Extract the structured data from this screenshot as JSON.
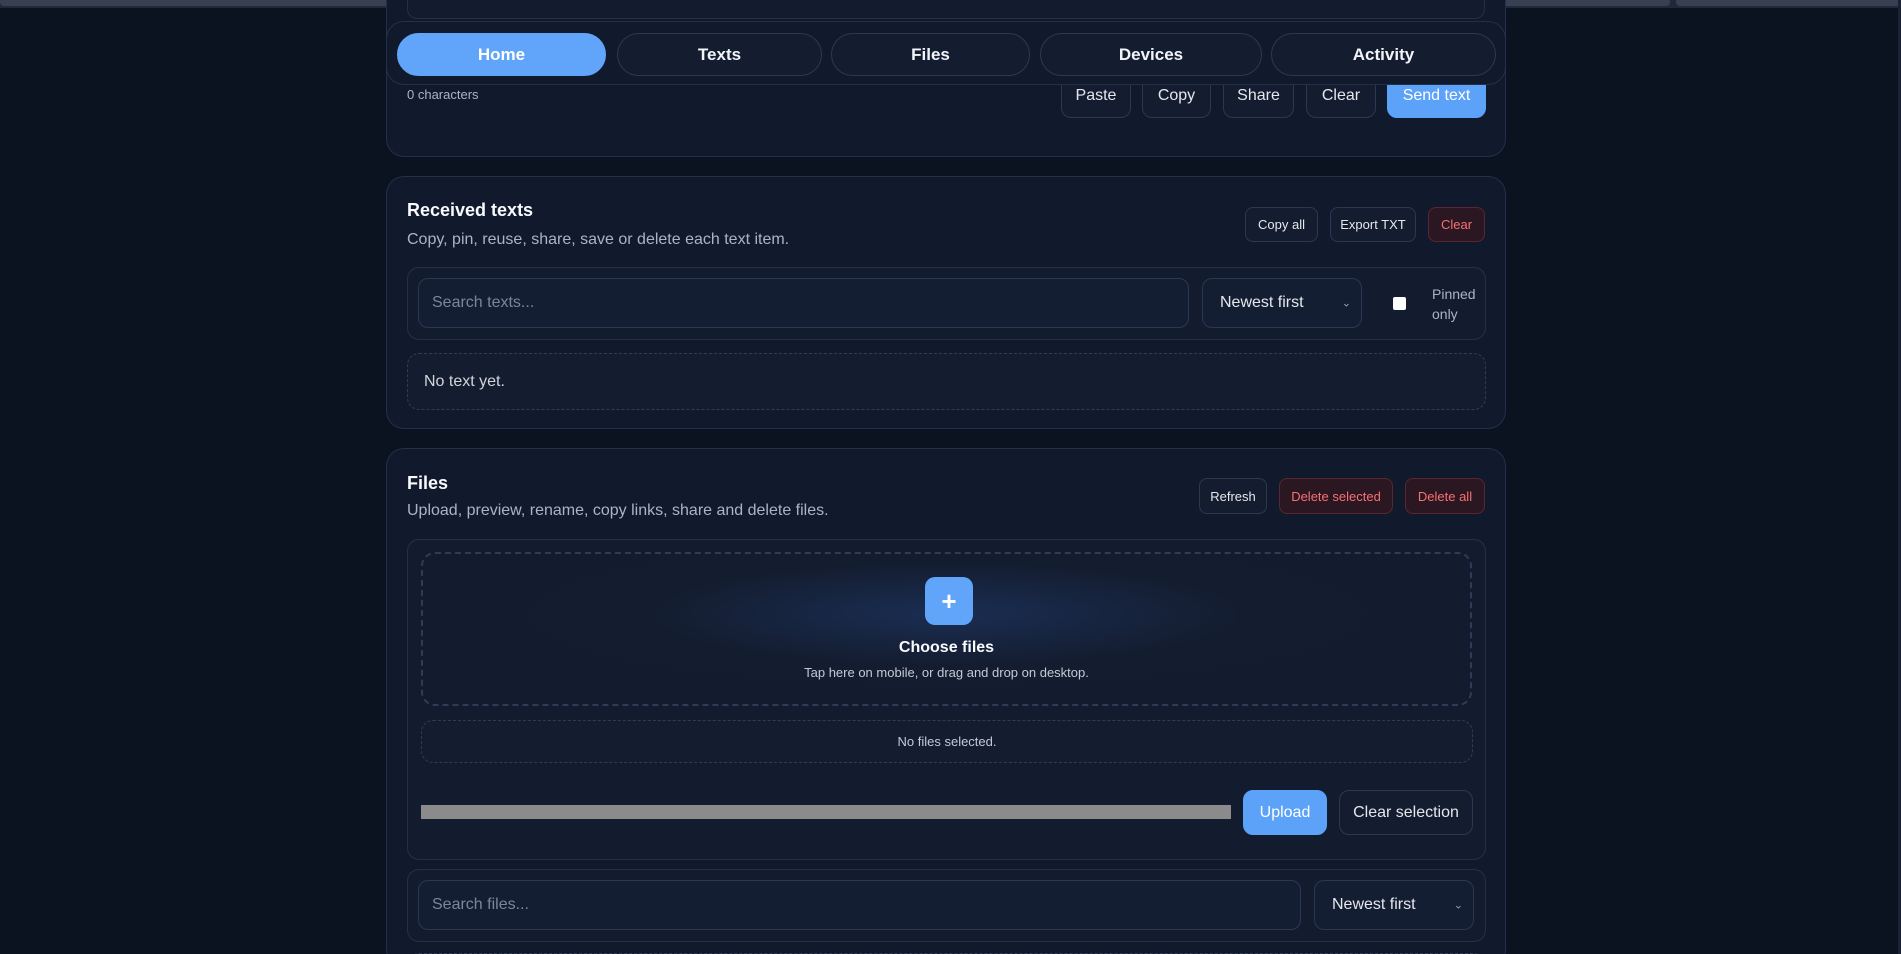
{
  "nav": {
    "tabs": [
      {
        "label": "Home",
        "active": true
      },
      {
        "label": "Texts",
        "active": false
      },
      {
        "label": "Files",
        "active": false
      },
      {
        "label": "Devices",
        "active": false
      },
      {
        "label": "Activity",
        "active": false
      }
    ]
  },
  "composer": {
    "char_count": "0 characters",
    "buttons": {
      "paste": "Paste",
      "copy": "Copy",
      "share": "Share",
      "clear": "Clear",
      "send": "Send text"
    }
  },
  "received": {
    "title": "Received texts",
    "subtitle": "Copy, pin, reuse, share, save or delete each text item.",
    "buttons": {
      "copy_all": "Copy all",
      "export": "Export TXT",
      "clear": "Clear"
    },
    "search_placeholder": "Search texts...",
    "sort_selected": "Newest first",
    "pinned_label_1": "Pinned",
    "pinned_label_2": "only",
    "empty": "No text yet."
  },
  "files": {
    "title": "Files",
    "subtitle": "Upload, preview, rename, copy links, share and delete files.",
    "buttons": {
      "refresh": "Refresh",
      "delete_selected": "Delete selected",
      "delete_all": "Delete all",
      "upload": "Upload",
      "clear_selection": "Clear selection"
    },
    "dropzone": {
      "icon": "+",
      "title": "Choose files",
      "hint": "Tap here on mobile, or drag and drop on desktop."
    },
    "selected_status": "No files selected.",
    "upload_progress": 0,
    "search_placeholder": "Search files...",
    "sort_selected": "Newest first"
  },
  "colors": {
    "background": "#0b1220",
    "card": "#111a2c",
    "accent": "#60a5fa",
    "danger": "#f87171"
  }
}
